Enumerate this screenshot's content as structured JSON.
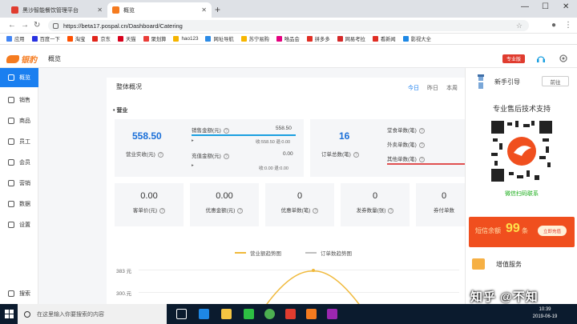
{
  "browser": {
    "tabs": [
      {
        "title": "黑沙智能餐饮管理平台",
        "favicon_color": "#e03c2f"
      },
      {
        "title": "概览",
        "favicon_color": "#f57b1f"
      }
    ],
    "url": "https://beta17.pospal.cn/Dashboard/Catering",
    "bookmarks": [
      {
        "label": "应用",
        "color": "#4285f4"
      },
      {
        "label": "百度一下",
        "color": "#2932e1"
      },
      {
        "label": "淘宝",
        "color": "#ff5000"
      },
      {
        "label": "京东",
        "color": "#e1251b"
      },
      {
        "label": "天猫",
        "color": "#d8001b"
      },
      {
        "label": "聚划算",
        "color": "#ea3d38"
      },
      {
        "label": "hao123",
        "color": "#f5b400"
      },
      {
        "label": "网址导航",
        "color": "#2c8be6"
      },
      {
        "label": "苏宁易购",
        "color": "#f7b600"
      },
      {
        "label": "唯品会",
        "color": "#e4007f"
      },
      {
        "label": "拼多多",
        "color": "#e02e24"
      },
      {
        "label": "网易考拉",
        "color": "#d52828"
      },
      {
        "label": "看新闻",
        "color": "#e02e24"
      },
      {
        "label": "影视大全",
        "color": "#1e88e5"
      }
    ]
  },
  "app": {
    "logo_text": "银豹",
    "breadcrumb": "概览",
    "pro_badge": "专业版"
  },
  "sidebar": {
    "items": [
      {
        "label": "概览",
        "icon": "home-icon",
        "active": true
      },
      {
        "label": "销售",
        "icon": "sales-icon"
      },
      {
        "label": "商品",
        "icon": "goods-icon"
      },
      {
        "label": "员工",
        "icon": "staff-icon"
      },
      {
        "label": "会员",
        "icon": "member-icon"
      },
      {
        "label": "营销",
        "icon": "marketing-icon"
      },
      {
        "label": "数据",
        "icon": "data-icon"
      },
      {
        "label": "设置",
        "icon": "settings-icon"
      },
      {
        "label": "搜索",
        "icon": "search-icon"
      }
    ]
  },
  "overview": {
    "title": "整体概况",
    "ranges": [
      "今日",
      "昨日",
      "本周"
    ],
    "selected_range": "今日",
    "section": "• 营业",
    "revenue": {
      "value": "558.50",
      "label": "营业实收(元)",
      "sales_label": "销售金额(元)",
      "sales_value": "558.50",
      "sales_sub": "收:558.50 退:0.00",
      "recharge_label": "充值金额(元)",
      "recharge_value": "0.00",
      "recharge_sub": "收:0.00 退:0.00"
    },
    "orders": {
      "value": "16",
      "label": "订单总数(笔)",
      "dine_label": "堂食单数(笔)",
      "takeout_label": "外卖单数(笔)",
      "other_label": "其他单数(笔)"
    },
    "metrics": [
      {
        "value": "0.00",
        "label": "客单价(元)"
      },
      {
        "value": "0.00",
        "label": "优惠金额(元)"
      },
      {
        "value": "0",
        "label": "优惠单数(笔)"
      },
      {
        "value": "0",
        "label": "发券数量(张)"
      },
      {
        "value": "0",
        "label": "券付单数"
      }
    ],
    "legend": [
      "营业额趋势图",
      "订单数趋势图"
    ],
    "y_ticks": [
      "383 元",
      "300.元"
    ]
  },
  "chart_data": {
    "type": "line",
    "series": [
      {
        "name": "营业额趋势图",
        "color": "#f0b93a"
      },
      {
        "name": "订单数趋势图",
        "color": "#bfbfbf"
      }
    ],
    "y_ticks": [
      "383 元",
      "300.元"
    ]
  },
  "right_panel": {
    "guide_title": "新手引导",
    "guide_button": "前往",
    "support_title": "专业售后技术支持",
    "qr_caption": "微信扫码联系",
    "promo_text": "短信余额",
    "promo_number": "99",
    "promo_unit": "条",
    "promo_button": "立即充值",
    "service_label": "增值服务"
  },
  "taskbar": {
    "search_placeholder": "在这里输入你要搜索的内容",
    "time": "10:39",
    "date": "2019-06-19"
  },
  "watermark": "知乎 @不知"
}
